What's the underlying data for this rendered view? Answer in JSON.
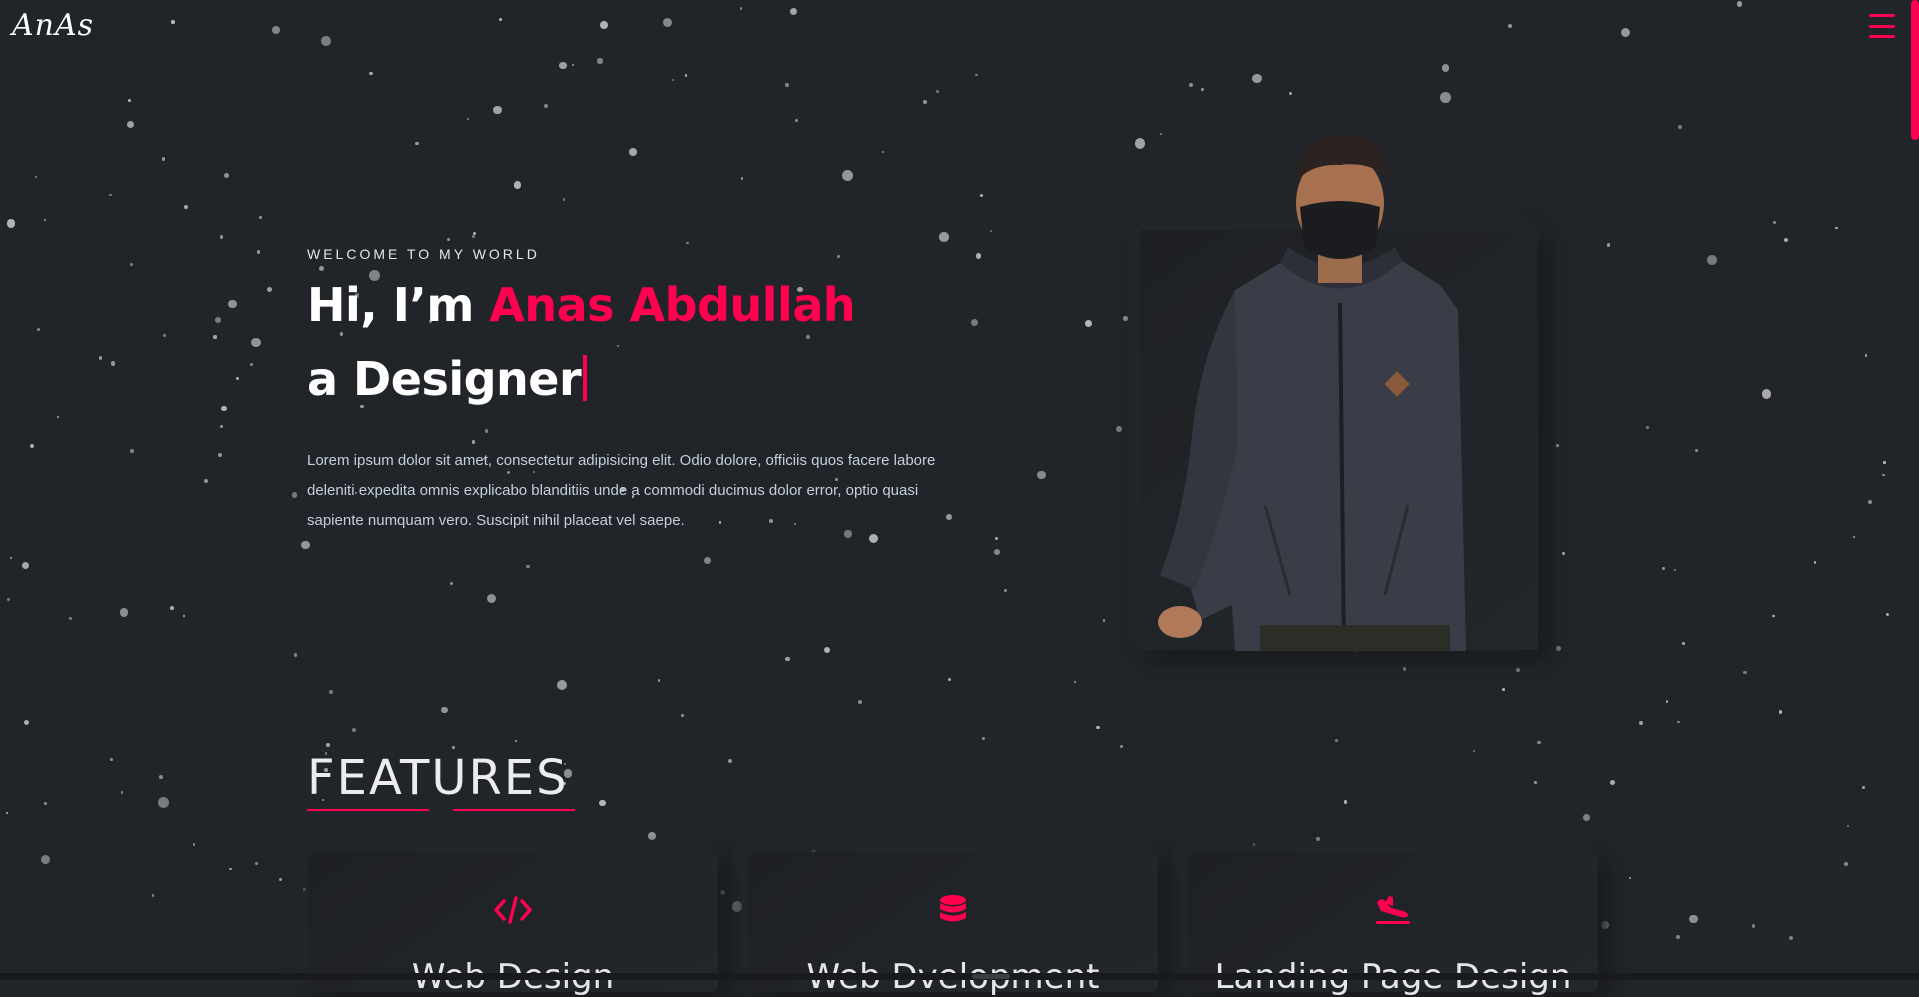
{
  "header": {
    "logo": "AnAs",
    "menu_icon": "hamburger-menu-icon"
  },
  "hero": {
    "welcome": "WELCOME TO MY WORLD",
    "greeting": "Hi, I’m ",
    "name": "Anas Abdullah",
    "role_line": "a Designer",
    "description": "Lorem ipsum dolor sit amet, consectetur adipisicing elit. Odio dolore, officiis quos facere labore deleniti expedita omnis explicabo blanditiis unde a commodi ducimus dolor error, optio quasi sapiente numquam vero. Suscipit nihil placeat vel saepe."
  },
  "features": {
    "title": "FEATURES",
    "cards": [
      {
        "icon": "code-icon",
        "title": "Web Design"
      },
      {
        "icon": "database-icon",
        "title": "Web Dvelopment"
      },
      {
        "icon": "plane-landing-icon",
        "title": "Landing Page Design"
      }
    ]
  },
  "colors": {
    "background": "#212428",
    "accent": "#ff014f",
    "text": "#ffffff",
    "muted_text": "#c4cfde",
    "star": "#bdbdbd"
  }
}
